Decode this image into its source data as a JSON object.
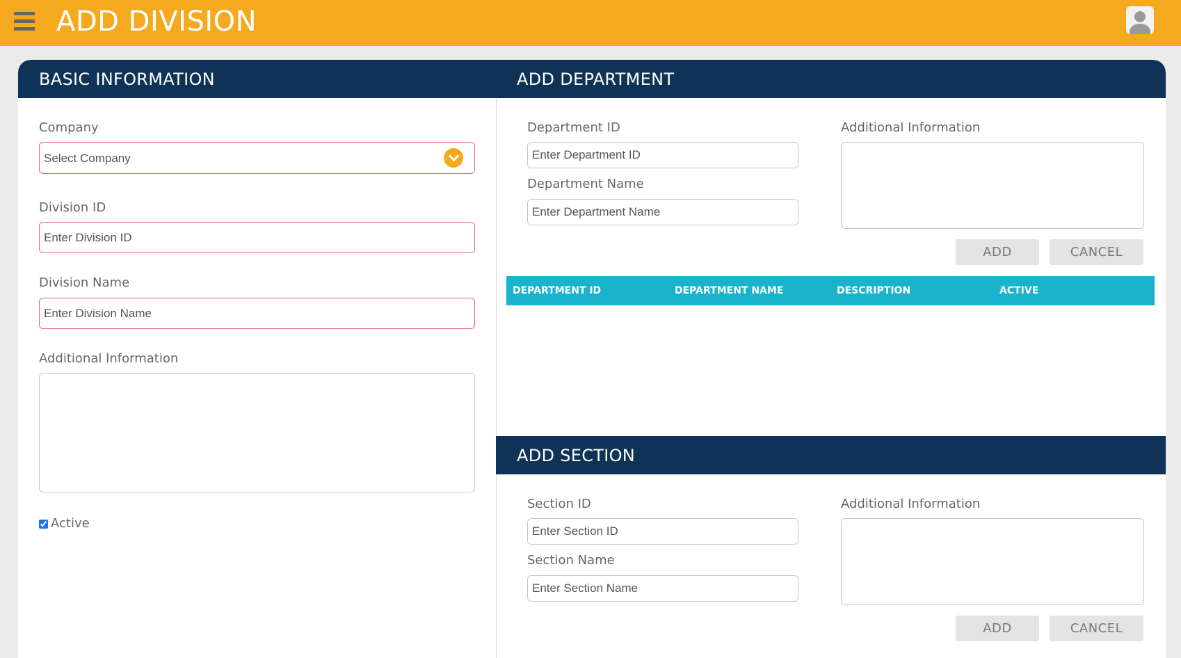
{
  "header": {
    "title": "ADD DIVISION"
  },
  "basic": {
    "title": "BASIC INFORMATION",
    "company_label": "Company",
    "company_value": "Select Company",
    "division_id_label": "Division ID",
    "division_id_placeholder": "Enter Division ID",
    "division_name_label": "Division Name",
    "division_name_placeholder": "Enter Division Name",
    "additional_label": "Additional Information",
    "active_label": "Active",
    "active_checked": true
  },
  "department": {
    "title": "ADD DEPARTMENT",
    "id_label": "Department ID",
    "id_placeholder": "Enter Department ID",
    "name_label": "Department Name",
    "name_placeholder": "Enter Department Name",
    "additional_label": "Additional Information",
    "add_button": "ADD",
    "cancel_button": "CANCEL",
    "table_columns": [
      "DEPARTMENT ID",
      "DEPARTMENT NAME",
      "DESCRIPTION",
      "ACTIVE"
    ]
  },
  "section": {
    "title": "ADD SECTION",
    "id_label": "Section ID",
    "id_placeholder": "Enter Section ID",
    "name_label": "Section Name",
    "name_placeholder": "Enter Section Name",
    "additional_label": "Additional Information",
    "add_button": "ADD",
    "cancel_button": "CANCEL"
  },
  "colors": {
    "topbar": "#f5a91e",
    "panel_header": "#0f3357",
    "table_header": "#1bb3cc",
    "required_border": "#e6666d"
  }
}
